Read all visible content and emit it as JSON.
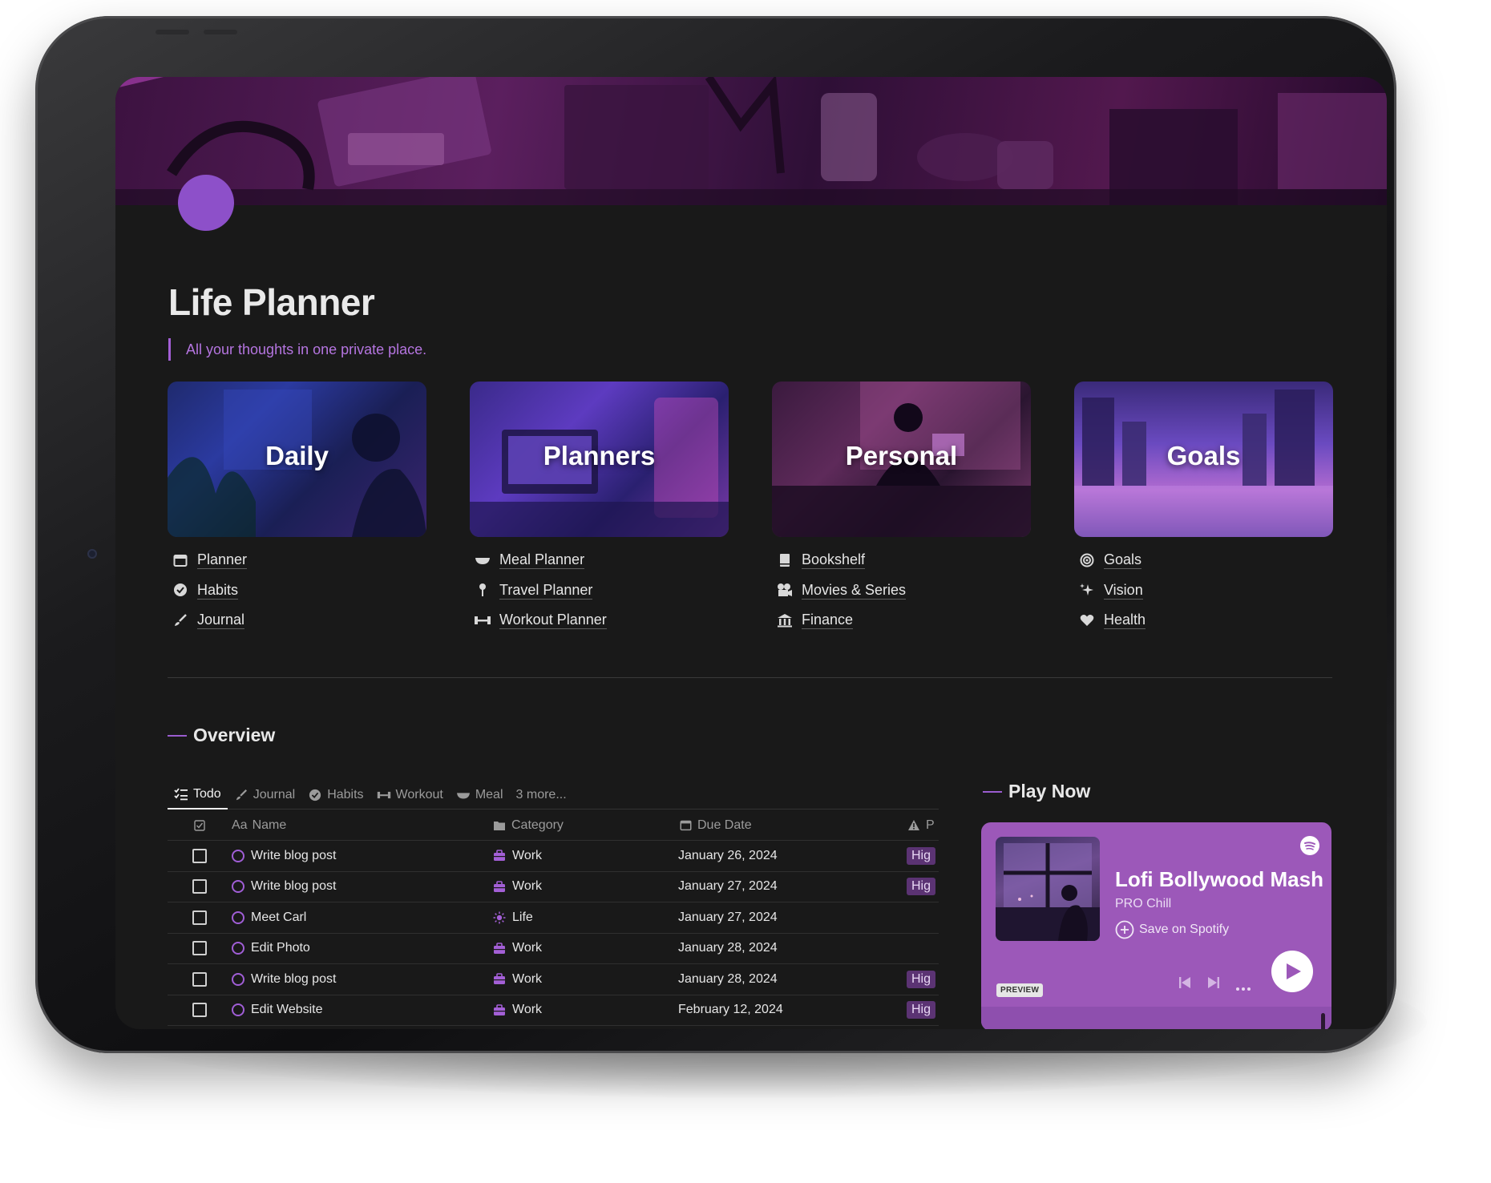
{
  "page": {
    "title": "Life Planner",
    "quote": "All your thoughts in one private place."
  },
  "cards": [
    {
      "label": "Daily",
      "links": [
        {
          "icon": "calendar-icon",
          "label": "Planner"
        },
        {
          "icon": "check-circle-icon",
          "label": "Habits"
        },
        {
          "icon": "brush-icon",
          "label": "Journal"
        }
      ]
    },
    {
      "label": "Planners",
      "links": [
        {
          "icon": "bowl-icon",
          "label": "Meal Planner"
        },
        {
          "icon": "pin-icon",
          "label": "Travel Planner"
        },
        {
          "icon": "dumbbell-icon",
          "label": "Workout Planner"
        }
      ]
    },
    {
      "label": "Personal",
      "links": [
        {
          "icon": "book-icon",
          "label": "Bookshelf"
        },
        {
          "icon": "film-camera-icon",
          "label": "Movies & Series"
        },
        {
          "icon": "bank-icon",
          "label": "Finance"
        }
      ]
    },
    {
      "label": "Goals",
      "links": [
        {
          "icon": "target-icon",
          "label": "Goals"
        },
        {
          "icon": "sparkle-icon",
          "label": "Vision"
        },
        {
          "icon": "heart-icon",
          "label": "Health"
        }
      ]
    }
  ],
  "overview": {
    "heading": "Overview",
    "tabs": [
      {
        "icon": "checklist-icon",
        "label": "Todo",
        "active": true
      },
      {
        "icon": "brush-icon",
        "label": "Journal"
      },
      {
        "icon": "check-circle-icon",
        "label": "Habits"
      },
      {
        "icon": "dumbbell-icon",
        "label": "Workout"
      },
      {
        "icon": "bowl-icon",
        "label": "Meal"
      },
      {
        "label": "3 more..."
      }
    ],
    "columns": {
      "name": "Name",
      "name_prefix": "Aa",
      "category": "Category",
      "due": "Due Date",
      "priority": "P"
    },
    "rows": [
      {
        "name": "Write blog post",
        "category": "Work",
        "cat_icon": "briefcase-icon",
        "due": "January 26, 2024",
        "priority": "Hig"
      },
      {
        "name": "Write blog post",
        "category": "Work",
        "cat_icon": "briefcase-icon",
        "due": "January 27, 2024",
        "priority": "Hig"
      },
      {
        "name": "Meet Carl",
        "category": "Life",
        "cat_icon": "sun-icon",
        "due": "January 27, 2024",
        "priority": ""
      },
      {
        "name": "Edit Photo",
        "category": "Work",
        "cat_icon": "briefcase-icon",
        "due": "January 28, 2024",
        "priority": ""
      },
      {
        "name": "Write blog post",
        "category": "Work",
        "cat_icon": "briefcase-icon",
        "due": "January 28, 2024",
        "priority": "Hig"
      },
      {
        "name": "Edit Website",
        "category": "Work",
        "cat_icon": "briefcase-icon",
        "due": "February 12, 2024",
        "priority": "Hig"
      }
    ]
  },
  "player": {
    "heading": "Play Now",
    "song": "Lofi Bollywood Mash",
    "artist": "PRO Chill",
    "save": "Save on Spotify",
    "preview": "PREVIEW"
  },
  "colors": {
    "accent": "#a35fd6",
    "background": "#191919",
    "spotify_card": "#9c58b9",
    "tag_high": "#5b3373"
  }
}
